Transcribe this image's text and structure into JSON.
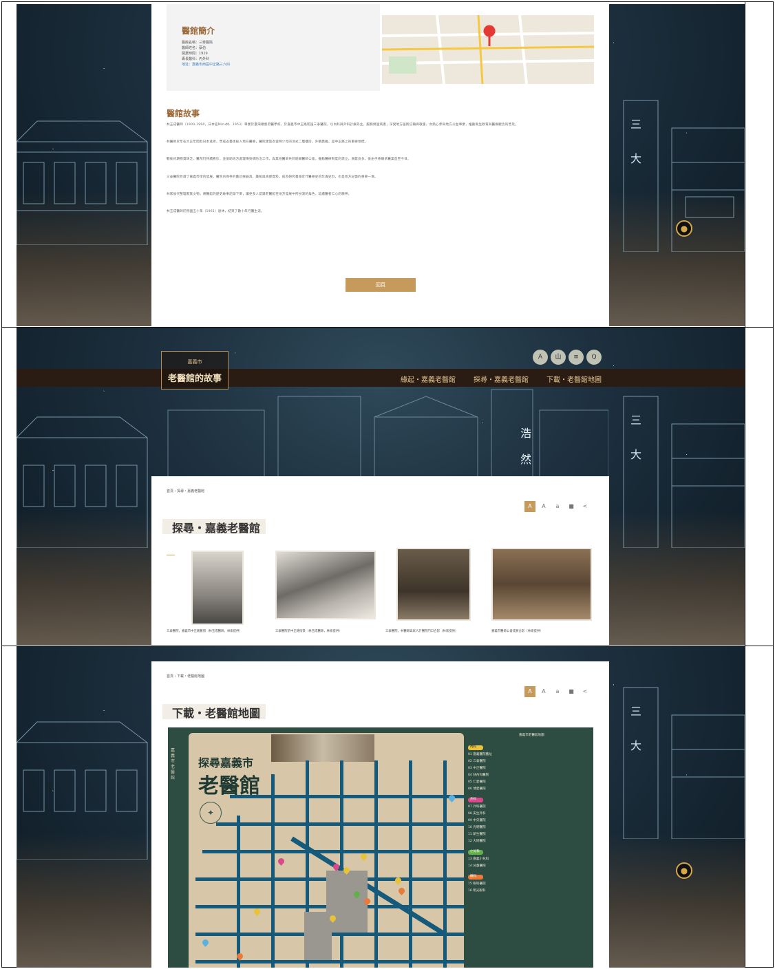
{
  "panel1": {
    "info_title": "醫館簡介",
    "info_lines": [
      "醫館名稱：三泰醫院",
      "醫師姓名：蔡伯",
      "開業時間：1929",
      "專長醫科：內外科",
      "地址：嘉義市西區中正路三六四"
    ],
    "story_title": "醫館故事",
    "paragraphs": [
      "林玉成醫師（1900-1990，日本名Mizu林、1953）畢業於臺灣總督府醫學校，於嘉義市中正路開設三泰醫院，以內科與外科診療為主，服務鄰里病患，深受地方居民信賴與敬重，亦熱心參與地方公益事業，推動衛生教育與醫療觀念的普及。",
      "林醫師早年在大正年間赴日本進修，學成返臺後投入地方醫療，醫院建築為當時少見的洋式二層樓房，外觀典雅，是中正路上的重要地標。",
      "戰後初期物資缺乏，醫院仍持續看診，並協助地方處理傳染病防治工作，與其他醫師共同組織醫師公會，推動醫療制度的建立，貢獻良多，後由子孫繼承醫業直至今日。",
      "三泰醫院見證了嘉義市街的發展，醫院內保存的舊診療器具、藥瓶與病歷資料，成為研究臺灣近代醫療史的珍貴史料，也是地方記憶的重要一環。",
      "林家後代整理家族文物，將醫館的歷史故事記錄下來，讓更多人認識老醫館在地方發展中所扮演的角色，延續醫者仁心的精神。",
      "林玉成醫師於民國五十年（1961）退休，結束了數十年行醫生涯。"
    ],
    "back_button": "回頁"
  },
  "panel2": {
    "logo_sub": "嘉義市",
    "logo_main": "老醫館的故事",
    "nav_items": [
      "緣起・嘉義老醫館",
      "探尋・嘉義老醫館",
      "下載・老醫館地圖"
    ],
    "top_icons": [
      "A",
      "山",
      "≡",
      "Q"
    ],
    "breadcrumb": "首頁 › 探尋・嘉義老醫館",
    "title": "探尋・嘉義老醫館",
    "building_sign": [
      "浩",
      "然"
    ],
    "photos": [
      {
        "caption": "三泰醫院，嘉義市中正路舊照（林玉成醫師，林家提供）"
      },
      {
        "caption": "三泰醫院前中正路街景（林玉成醫師，林家提供）"
      },
      {
        "caption": "三泰醫院，林醫師與家人於醫院門口合影（林家提供）"
      },
      {
        "caption": "嘉義市醫師公會成員合影（林家提供）"
      }
    ]
  },
  "panel3": {
    "breadcrumb": "首頁 › 下載・老醫館地圖",
    "title": "下載・老醫館地圖",
    "map_title_small": "探尋嘉義市",
    "map_title_big": "老醫館",
    "map_side_label": "嘉義市老醫館",
    "map_top_right": "嘉義市老醫館地圖",
    "legend": [
      {
        "tag": "內科",
        "color": "#e8c238",
        "items": [
          "01 嘉義醫院舊址",
          "02 三泰醫院",
          "03 中正醫院",
          "04 林內科醫院",
          "05 仁愛醫院",
          "06 博愛醫院"
        ]
      },
      {
        "tag": "外科",
        "color": "#d84a8a",
        "items": [
          "07 外科醫院",
          "08 安生外科",
          "09 中央醫院",
          "10 光明醫院",
          "11 新生醫院",
          "12 大同醫院"
        ]
      },
      {
        "tag": "小兒科",
        "color": "#63b04a",
        "items": [
          "13 嘉義小兒科",
          "14 兒童醫院"
        ]
      },
      {
        "tag": "眼科",
        "color": "#e87a3a",
        "items": [
          "15 眼科醫院",
          "16 明光眼科"
        ]
      }
    ]
  },
  "colors": {
    "accent_gold": "#c59a5b",
    "nav_bg": "#2a1c12",
    "map_green": "#2d4c42",
    "map_road": "#155a7a",
    "map_land": "#d8c6a9"
  }
}
